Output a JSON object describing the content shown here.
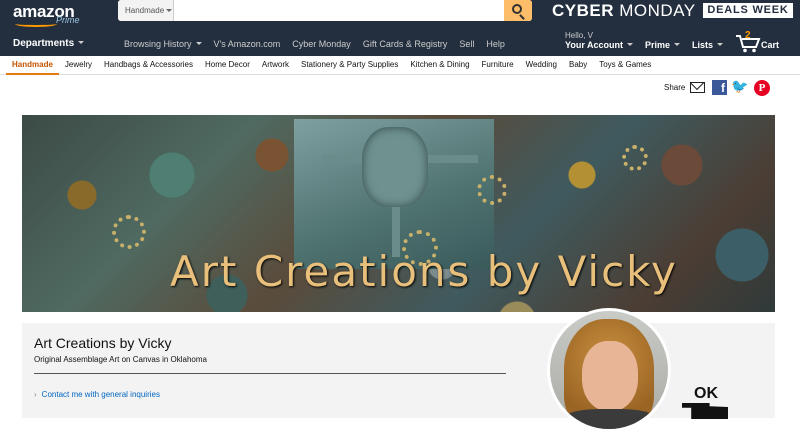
{
  "header": {
    "logo": "amazon",
    "logo_sub": "Prime",
    "search": {
      "department": "Handmade",
      "value": "",
      "placeholder": ""
    },
    "promo_light": "MONDAY",
    "promo_bold": "CYBER",
    "promo_badge": "DEALS WEEK"
  },
  "nav": {
    "departments": "Departments",
    "links": [
      "Browsing History",
      "V's Amazon.com",
      "Cyber Monday",
      "Gift Cards & Registry",
      "Sell",
      "Help"
    ],
    "hello": "Hello, V",
    "account": "Your Account",
    "prime": "Prime",
    "lists": "Lists",
    "cart_count": "2",
    "cart": "Cart"
  },
  "subnav": {
    "items": [
      "Handmade",
      "Jewelry",
      "Handbags & Accessories",
      "Home Decor",
      "Artwork",
      "Stationery & Party Supplies",
      "Kitchen & Dining",
      "Furniture",
      "Wedding",
      "Baby",
      "Toys & Games"
    ],
    "active": "Handmade"
  },
  "share": {
    "label": "Share"
  },
  "banner": {
    "title": "Art Creations by Vicky"
  },
  "profile": {
    "name": "Art Creations by Vicky",
    "tagline": "Original Assemblage Art on Canvas in Oklahoma",
    "contact": "Contact me with general inquiries",
    "badge": "OK"
  },
  "colors": {
    "nav_bg": "#232f3e",
    "search_btn": "#febd69",
    "accent": "#e47911",
    "link": "#0066c0"
  }
}
